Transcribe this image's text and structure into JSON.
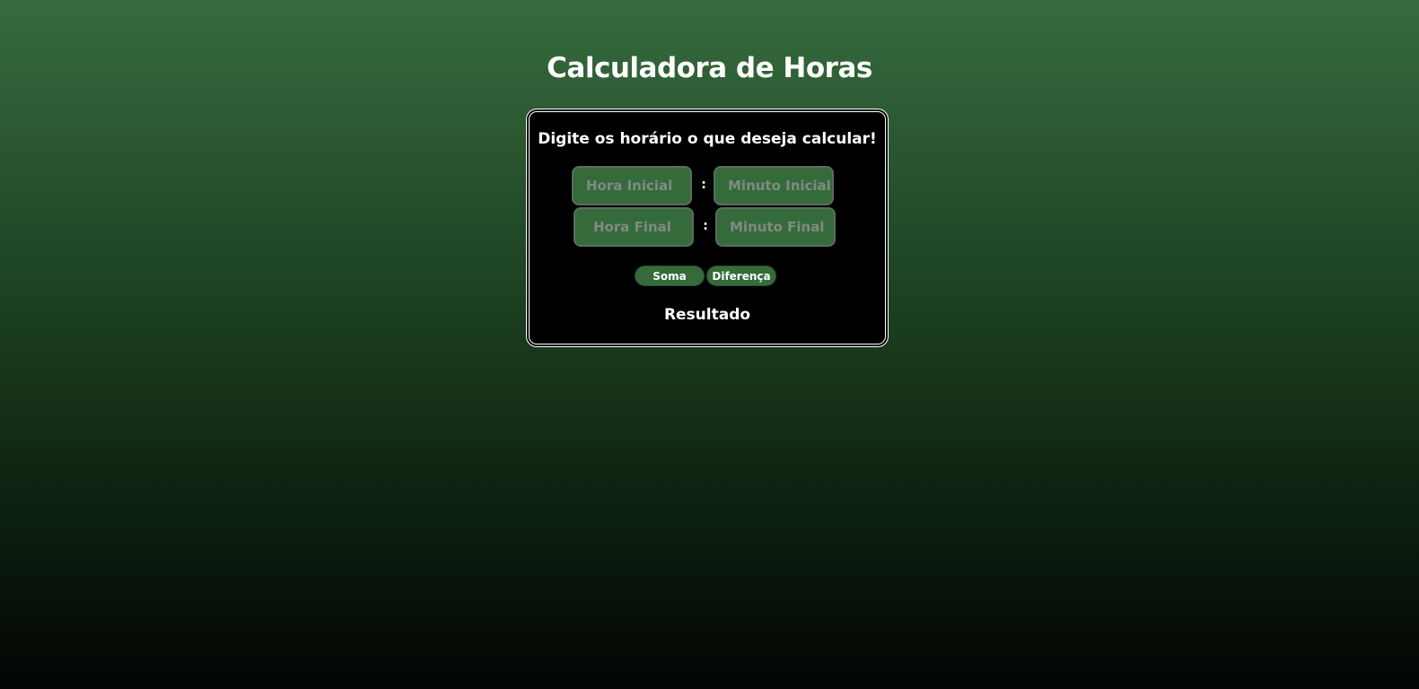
{
  "header": {
    "title": "Calculadora de Horas"
  },
  "card": {
    "subtitle": "Digite os horário o que deseja calcular!",
    "inputs": {
      "hora_inicial_placeholder": "Hora Inicial",
      "minuto_inicial_placeholder": "Minuto Inicial",
      "hora_final_placeholder": "Hora Final",
      "minuto_final_placeholder": "Minuto Final",
      "separator": ":"
    },
    "buttons": {
      "soma_label": "Soma",
      "diferenca_label": "Diferença"
    },
    "result_label": "Resultado"
  },
  "colors": {
    "accent_green": "#356b3b",
    "card_background": "#000000",
    "text": "#ffffff"
  }
}
